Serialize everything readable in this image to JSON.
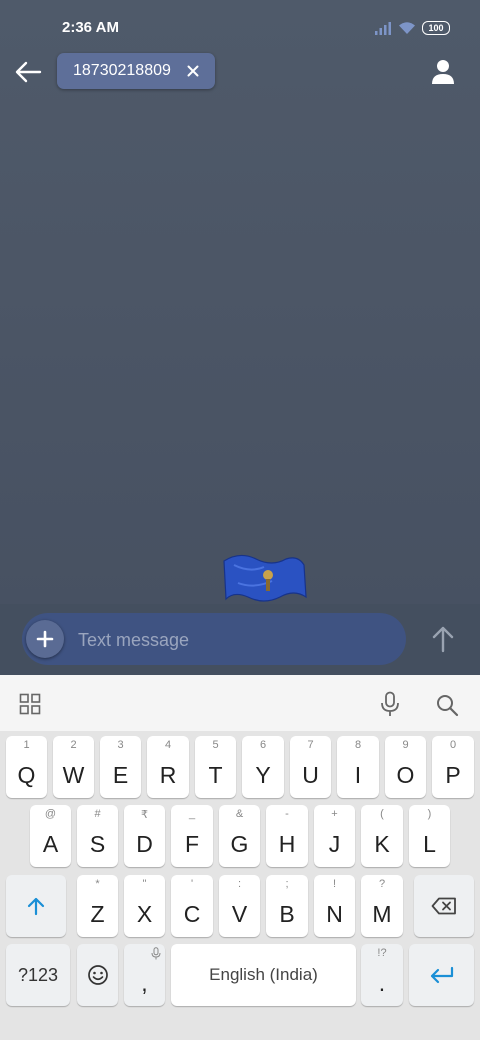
{
  "status_bar": {
    "time": "2:36 AM",
    "battery": "100",
    "icons": [
      "signal-icon",
      "wifi-icon",
      "battery-icon"
    ]
  },
  "header": {
    "recipient": "18730218809",
    "icons": [
      "back-arrow-icon",
      "close-icon",
      "contact-person-icon"
    ]
  },
  "compose": {
    "placeholder": "Text message",
    "value": "",
    "icons": [
      "plus-icon",
      "send-arrow-icon"
    ]
  },
  "keyboard": {
    "toolbar_icons": [
      "grid-apps-icon",
      "microphone-icon",
      "search-icon"
    ],
    "row1": [
      {
        "key": "Q",
        "hint": "1"
      },
      {
        "key": "W",
        "hint": "2"
      },
      {
        "key": "E",
        "hint": "3"
      },
      {
        "key": "R",
        "hint": "4"
      },
      {
        "key": "T",
        "hint": "5"
      },
      {
        "key": "Y",
        "hint": "6"
      },
      {
        "key": "U",
        "hint": "7"
      },
      {
        "key": "I",
        "hint": "8"
      },
      {
        "key": "O",
        "hint": "9"
      },
      {
        "key": "P",
        "hint": "0"
      }
    ],
    "row2": [
      {
        "key": "A",
        "hint": "@"
      },
      {
        "key": "S",
        "hint": "#"
      },
      {
        "key": "D",
        "hint": "₹"
      },
      {
        "key": "F",
        "hint": "_"
      },
      {
        "key": "G",
        "hint": "&"
      },
      {
        "key": "H",
        "hint": "-"
      },
      {
        "key": "J",
        "hint": "+"
      },
      {
        "key": "K",
        "hint": "("
      },
      {
        "key": "L",
        "hint": ")"
      }
    ],
    "row3": [
      {
        "key": "Z",
        "hint": "*"
      },
      {
        "key": "X",
        "hint": "\""
      },
      {
        "key": "C",
        "hint": "'"
      },
      {
        "key": "V",
        "hint": ":"
      },
      {
        "key": "B",
        "hint": ";"
      },
      {
        "key": "N",
        "hint": "!"
      },
      {
        "key": "M",
        "hint": "?"
      }
    ],
    "symbols_label": "?123",
    "comma": ",",
    "space_label": "English (India)",
    "period": ".",
    "period_hint": "!?",
    "row3_icons": [
      "shift-arrow-icon",
      "backspace-icon"
    ],
    "row4_icons": [
      "emoji-icon",
      "mic-small-icon",
      "enter-icon"
    ],
    "accent_color": "#1a8fd6"
  },
  "colors": {
    "background_top": "#4f5a6a",
    "compose_pill": "#3f5382",
    "recipient_chip": "#5e6f99"
  }
}
